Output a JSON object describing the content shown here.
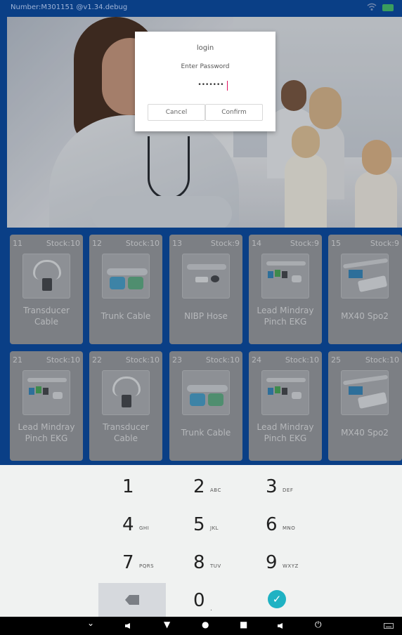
{
  "status": {
    "text": "Number:M301151 @v1.34.debug",
    "icons": [
      "wifi-icon",
      "battery-icon"
    ]
  },
  "dialog": {
    "title": "login",
    "prompt": "Enter Password",
    "password_value": "•••••••",
    "cancel_label": "Cancel",
    "confirm_label": "Confirm"
  },
  "products": [
    {
      "num": "11",
      "stock": "Stock:10",
      "name": "Transducer Cable",
      "icon": "transducer-cable-icon"
    },
    {
      "num": "12",
      "stock": "Stock:10",
      "name": "Trunk Cable",
      "icon": "trunk-cable-icon"
    },
    {
      "num": "13",
      "stock": "Stock:9",
      "name": "NIBP Hose",
      "icon": "nibp-hose-icon"
    },
    {
      "num": "14",
      "stock": "Stock:9",
      "name": "Lead Mindray Pinch EKG",
      "icon": "ekg-lead-icon"
    },
    {
      "num": "15",
      "stock": "Stock:9",
      "name": "MX40 Spo2",
      "icon": "spo2-sensor-icon"
    },
    {
      "num": "21",
      "stock": "Stock:10",
      "name": "Lead Mindray Pinch EKG",
      "icon": "ekg-lead-icon"
    },
    {
      "num": "22",
      "stock": "Stock:10",
      "name": "Transducer Cable",
      "icon": "transducer-cable-icon"
    },
    {
      "num": "23",
      "stock": "Stock:10",
      "name": "Trunk Cable",
      "icon": "trunk-cable-icon"
    },
    {
      "num": "24",
      "stock": "Stock:10",
      "name": "Lead Mindray Pinch EKG",
      "icon": "ekg-lead-icon"
    },
    {
      "num": "25",
      "stock": "Stock:10",
      "name": "MX40 Spo2",
      "icon": "spo2-sensor-icon"
    }
  ],
  "keypad": {
    "keys": [
      {
        "digit": "1",
        "letters": ""
      },
      {
        "digit": "2",
        "letters": "ABC"
      },
      {
        "digit": "3",
        "letters": "DEF"
      },
      {
        "digit": "4",
        "letters": "GHI"
      },
      {
        "digit": "5",
        "letters": "JKL"
      },
      {
        "digit": "6",
        "letters": "MNO"
      },
      {
        "digit": "7",
        "letters": "PQRS"
      },
      {
        "digit": "8",
        "letters": "TUV"
      },
      {
        "digit": "9",
        "letters": "WXYZ"
      }
    ],
    "zero": {
      "digit": "0",
      "letters": "."
    },
    "delete_icon": "backspace-icon",
    "confirm_icon": "check-icon",
    "check_glyph": "✓"
  },
  "navbar": {
    "icons": [
      "hide-keyboard-icon",
      "volume-down-icon",
      "back-icon",
      "home-icon",
      "recents-icon",
      "volume-up-icon",
      "power-icon",
      "keyboard-icon"
    ],
    "glyphs": {
      "hide": "⌄",
      "back": "▼",
      "home": "●",
      "recents": "■",
      "power": "⏻"
    }
  }
}
